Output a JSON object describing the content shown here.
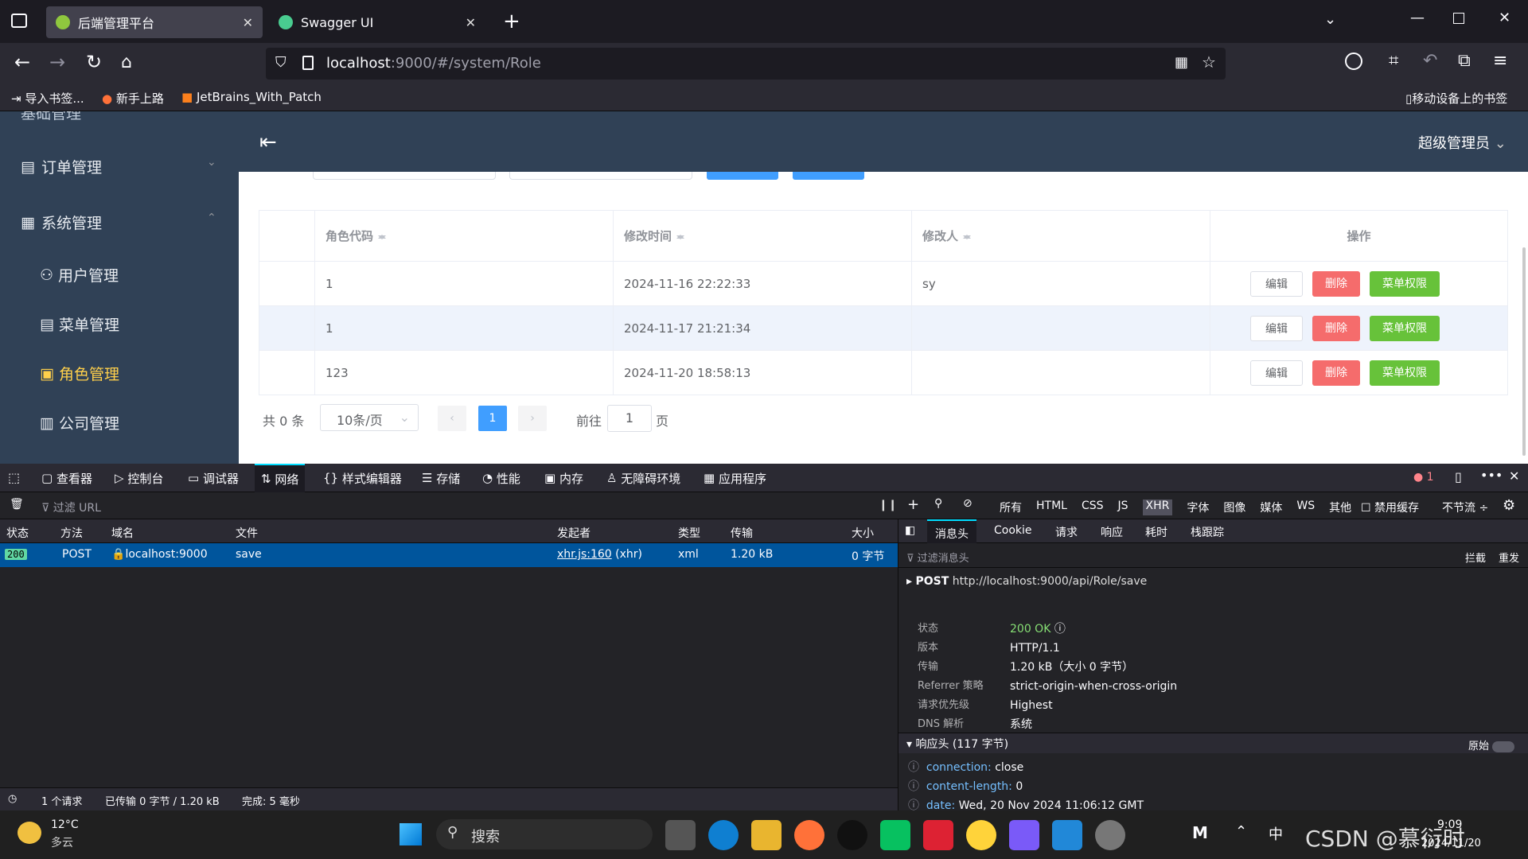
{
  "tabs": [
    {
      "title": "后端管理平台"
    },
    {
      "title": "Swagger UI"
    }
  ],
  "url": {
    "host": "localhost",
    "rest": ":9000/#/system/Role"
  },
  "bookmarks": {
    "items": [
      "导入书签...",
      "新手上路",
      "JetBrains_With_Patch"
    ],
    "mobile": "移动设备上的书签"
  },
  "sidebar": {
    "partial": "基础管理",
    "items": [
      {
        "label": "订单管理"
      },
      {
        "label": "系统管理"
      }
    ],
    "sub": [
      {
        "label": "用户管理"
      },
      {
        "label": "菜单管理"
      },
      {
        "label": "角色管理",
        "active": true
      },
      {
        "label": "公司管理"
      }
    ]
  },
  "header": {
    "user": "超级管理员"
  },
  "table": {
    "headers": [
      "角色代码",
      "修改时间",
      "修改人",
      "操作"
    ],
    "rows": [
      {
        "code": "1",
        "time": "2024-11-16 22:22:33",
        "user": "sy"
      },
      {
        "code": "1",
        "time": "2024-11-17 21:21:34",
        "user": ""
      },
      {
        "code": "123",
        "time": "2024-11-20 18:58:13",
        "user": ""
      }
    ],
    "actions": {
      "edit": "编辑",
      "delete": "删除",
      "menu": "菜单权限"
    }
  },
  "pagination": {
    "total": "共 0 条",
    "size": "10条/页",
    "page": "1",
    "goto": "前往",
    "goto_value": "1",
    "page_unit": "页"
  },
  "devtools": {
    "tabs": [
      "查看器",
      "控制台",
      "调试器",
      "网络",
      "样式编辑器",
      "存储",
      "性能",
      "内存",
      "无障碍环境",
      "应用程序"
    ],
    "error_count": "1",
    "filter_placeholder": "过滤 URL",
    "types": [
      "所有",
      "HTML",
      "CSS",
      "JS",
      "XHR",
      "字体",
      "图像",
      "媒体",
      "WS",
      "其他"
    ],
    "disable_cache": "禁用缓存",
    "throttle": "不节流 ÷",
    "columns": [
      "状态",
      "方法",
      "域名",
      "文件",
      "发起者",
      "类型",
      "传输",
      "大小"
    ],
    "request": {
      "status": "200",
      "method": "POST",
      "domain": "localhost:9000",
      "file": "save",
      "initiator": "xhr.js:160",
      "initiator_type": "(xhr)",
      "type": "xml",
      "transfer": "1.20 kB",
      "size": "0 字节"
    },
    "status": {
      "requests": "1 个请求",
      "transferred": "已传输 0 字节 / 1.20 kB",
      "finish": "完成: 5 毫秒"
    }
  },
  "details": {
    "tabs": [
      "消息头",
      "Cookie",
      "请求",
      "响应",
      "耗时",
      "栈跟踪"
    ],
    "filter": "过滤消息头",
    "block": "拦截",
    "resend": "重发",
    "post_label": "POST",
    "post_url": "http://localhost:9000/api/Role/save",
    "fields": [
      {
        "k": "状态",
        "v": "200 OK"
      },
      {
        "k": "版本",
        "v": "HTTP/1.1"
      },
      {
        "k": "传输",
        "v": "1.20 kB（大小 0 字节）"
      },
      {
        "k": "Referrer 策略",
        "v": "strict-origin-when-cross-origin"
      },
      {
        "k": "请求优先级",
        "v": "Highest"
      },
      {
        "k": "DNS 解析",
        "v": "系统"
      }
    ],
    "resp_header": "响应头 (117 字节)",
    "raw": "原始",
    "headers": [
      {
        "k": "connection:",
        "v": "close"
      },
      {
        "k": "content-length:",
        "v": "0"
      },
      {
        "k": "date:",
        "v": "Wed, 20 Nov 2024 11:06:12 GMT"
      }
    ]
  },
  "taskbar": {
    "temp": "12°C",
    "weather": "多云",
    "search": "搜索",
    "ime": "中",
    "time": "9:09",
    "date": "2024/11/20",
    "watermark": "CSDN @慕衍时"
  }
}
